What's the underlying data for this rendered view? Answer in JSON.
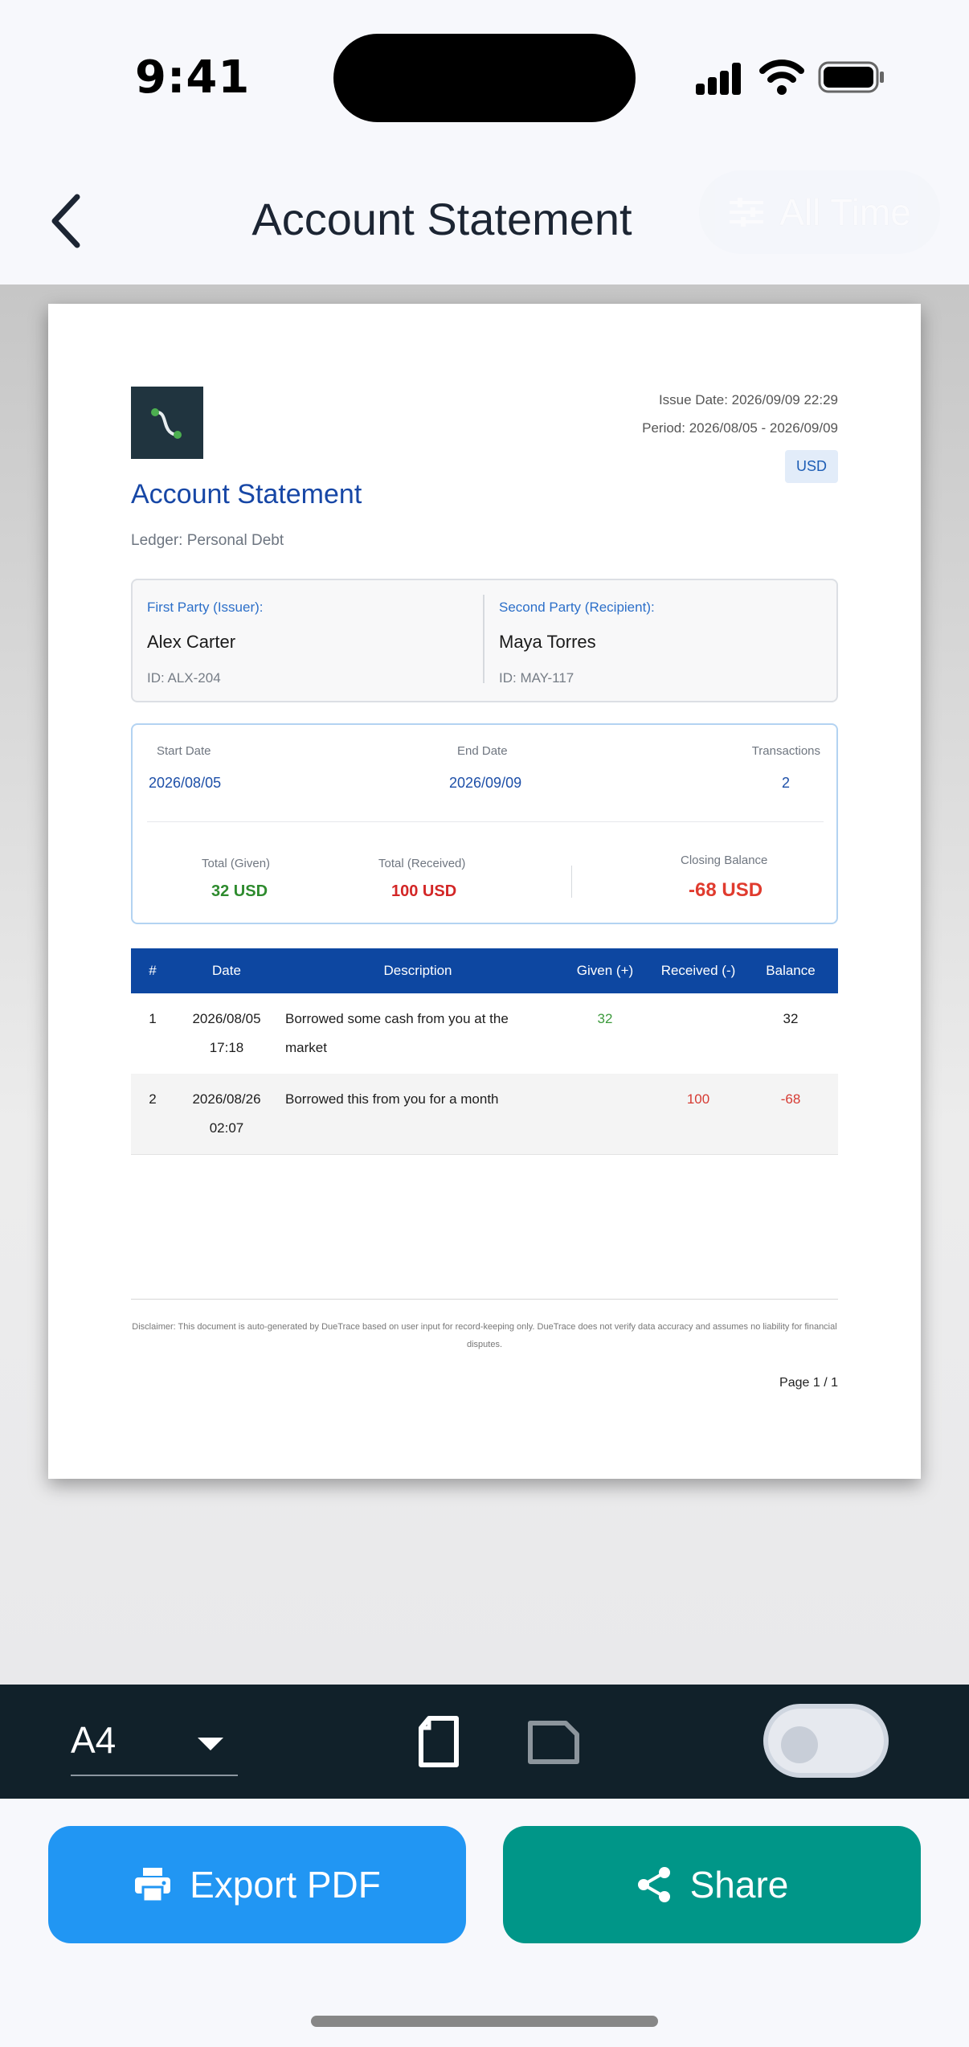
{
  "status": {
    "time": "9:41"
  },
  "header": {
    "title": "Account Statement",
    "filter_label": "All Time"
  },
  "document": {
    "title": "Account Statement",
    "ledger": "Ledger: Personal Debt",
    "issue_date": "Issue Date: 2026/09/09 22:29",
    "period": "Period: 2026/08/05 - 2026/09/09",
    "currency": "USD",
    "first_party": {
      "label": "First Party (Issuer):",
      "name": "Alex Carter",
      "id": "ID: ALX-204"
    },
    "second_party": {
      "label": "Second Party (Recipient):",
      "name": "Maya Torres",
      "id": "ID: MAY-117"
    },
    "summary": {
      "start_label": "Start Date",
      "start_value": "2026/08/05",
      "end_label": "End Date",
      "end_value": "2026/09/09",
      "tx_label": "Transactions",
      "tx_value": "2",
      "given_label": "Total (Given)",
      "given_value": "32 USD",
      "received_label": "Total (Received)",
      "received_value": "100 USD",
      "closing_label": "Closing Balance",
      "closing_value": "-68 USD"
    },
    "table": {
      "headers": [
        "#",
        "Date",
        "Description",
        "Given (+)",
        "Received (-)",
        "Balance"
      ],
      "rows": [
        {
          "no": "1",
          "date": "2026/08/05",
          "time": "17:18",
          "desc": "Borrowed some cash from you at the market",
          "given": "32",
          "received": "",
          "balance": "32"
        },
        {
          "no": "2",
          "date": "2026/08/26",
          "time": "02:07",
          "desc": "Borrowed this from you for a month",
          "given": "",
          "received": "100",
          "balance": "-68"
        }
      ]
    },
    "disclaimer": "Disclaimer: This document is auto-generated by DueTrace based on user input for record-keeping only. DueTrace does not verify data accuracy and assumes no liability for financial disputes.",
    "page": "Page 1 / 1"
  },
  "toolbar": {
    "paper_size": "A4",
    "orientation": "portrait",
    "toggle_on": false
  },
  "actions": {
    "export_label": "Export PDF",
    "share_label": "Share"
  },
  "colors": {
    "export": "#2196f3",
    "share": "#009688",
    "table_header": "#0d47a1",
    "toolbar_bg": "#11212a"
  }
}
